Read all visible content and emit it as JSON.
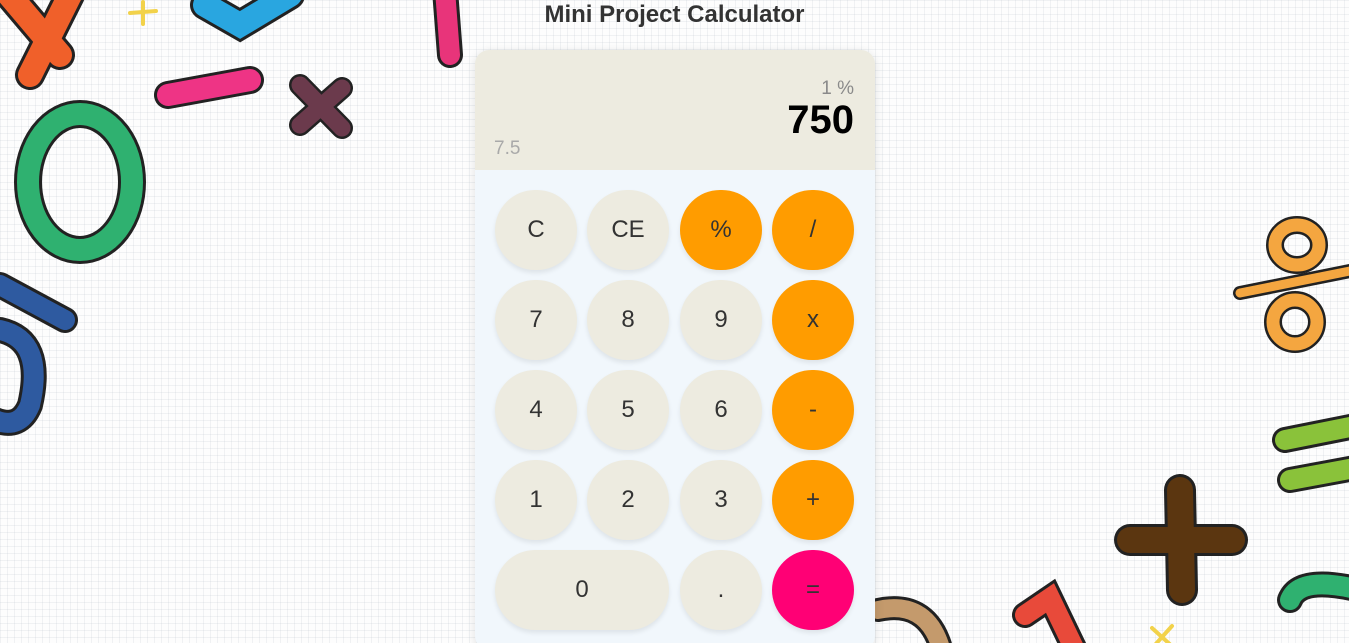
{
  "page": {
    "title": "Mini Project Calculator"
  },
  "display": {
    "expression": "1 %",
    "result": "750",
    "previous": "7.5"
  },
  "buttons": {
    "clear": "C",
    "clear_entry": "CE",
    "percent": "%",
    "divide": "/",
    "seven": "7",
    "eight": "8",
    "nine": "9",
    "multiply": "x",
    "four": "4",
    "five": "5",
    "six": "6",
    "subtract": "-",
    "one": "1",
    "two": "2",
    "three": "3",
    "add": "+",
    "zero": "0",
    "decimal": ".",
    "equals": "="
  },
  "colors": {
    "operator": "#ff9c00",
    "equals": "#ff0075",
    "number_key": "#edebe0",
    "display_bg": "#edebe0",
    "keypad_bg": "#f1f7fc"
  }
}
